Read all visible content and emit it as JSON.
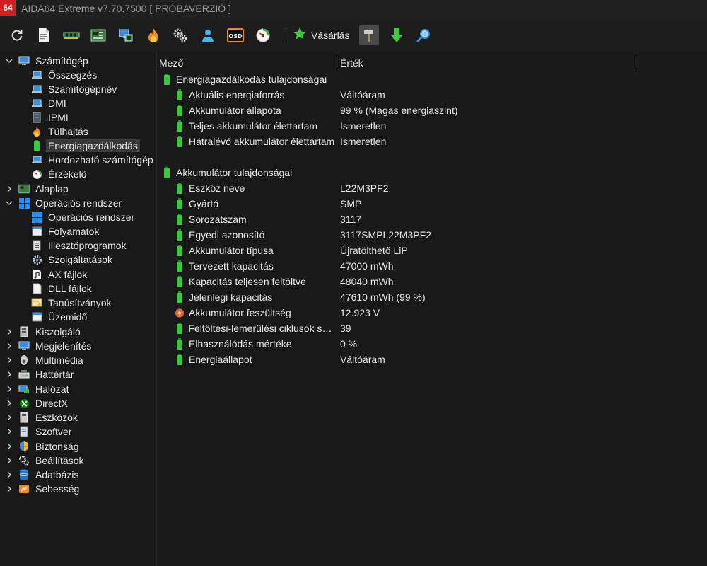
{
  "window": {
    "title": "AIDA64 Extreme v7.70.7500  [ PRÓBAVERZIÓ ]",
    "logo_text": "64"
  },
  "toolbar": {
    "buttons": [
      {
        "name": "refresh-icon"
      },
      {
        "name": "report-icon"
      },
      {
        "name": "memory-icon"
      },
      {
        "name": "motherboard-icon"
      },
      {
        "name": "network-icon"
      },
      {
        "name": "flame-icon"
      },
      {
        "name": "settings-gears-icon"
      },
      {
        "name": "user-icon"
      },
      {
        "name": "osd-icon"
      },
      {
        "name": "sensor-gauge-icon"
      }
    ],
    "buy_label": "Vásárlás",
    "osd_text": "OSD"
  },
  "tree": {
    "items": [
      {
        "label": "Számítógép"
      },
      {
        "label": "Összegzés"
      },
      {
        "label": "Számítógépnév"
      },
      {
        "label": "DMI"
      },
      {
        "label": "IPMI"
      },
      {
        "label": "Túlhajtás"
      },
      {
        "label": "Energiagazdálkodás"
      },
      {
        "label": "Hordozható számítógép"
      },
      {
        "label": "Érzékelő"
      },
      {
        "label": "Alaplap"
      },
      {
        "label": "Operációs rendszer"
      },
      {
        "label": "Operációs rendszer"
      },
      {
        "label": "Folyamatok"
      },
      {
        "label": "Illesztőprogramok"
      },
      {
        "label": "Szolgáltatások"
      },
      {
        "label": "AX fájlok"
      },
      {
        "label": "DLL fájlok"
      },
      {
        "label": "Tanúsítványok"
      },
      {
        "label": "Üzemidő"
      },
      {
        "label": "Kiszolgáló"
      },
      {
        "label": "Megjelenítés"
      },
      {
        "label": "Multimédia"
      },
      {
        "label": "Háttértár"
      },
      {
        "label": "Hálózat"
      },
      {
        "label": "DirectX"
      },
      {
        "label": "Eszközök"
      },
      {
        "label": "Szoftver"
      },
      {
        "label": "Biztonság"
      },
      {
        "label": "Beállítások"
      },
      {
        "label": "Adatbázis"
      },
      {
        "label": "Sebesség"
      }
    ]
  },
  "list": {
    "columns": {
      "field": "Mező",
      "value": "Érték"
    },
    "groups": [
      {
        "title": "Energiagazdálkodás tulajdonságai",
        "rows": [
          {
            "field": "Aktuális energiaforrás",
            "value": "Váltóáram"
          },
          {
            "field": "Akkumulátor állapota",
            "value": "99 % (Magas energiaszint)"
          },
          {
            "field": "Teljes akkumulátor élettartam",
            "value": "Ismeretlen"
          },
          {
            "field": "Hátralévő akkumulátor élettartam",
            "value": "Ismeretlen"
          }
        ]
      },
      {
        "title": "Akkumulátor tulajdonságai",
        "rows": [
          {
            "field": "Eszköz neve",
            "value": "L22M3PF2"
          },
          {
            "field": "Gyártó",
            "value": "SMP"
          },
          {
            "field": "Sorozatszám",
            "value": "3117"
          },
          {
            "field": "Egyedi azonosító",
            "value": "3117SMPL22M3PF2"
          },
          {
            "field": "Akkumulátor típusa",
            "value": "Újratölthető LiP"
          },
          {
            "field": "Tervezett kapacitás",
            "value": "47000 mWh"
          },
          {
            "field": "Kapacitás teljesen feltöltve",
            "value": "48040 mWh"
          },
          {
            "field": "Jelenlegi kapacitás",
            "value": "47610 mWh  (99 %)"
          },
          {
            "field": "Akkumulátor feszültség",
            "value": "12.923 V"
          },
          {
            "field": "Feltöltési-lemerülési ciklusok szá...",
            "value": "39"
          },
          {
            "field": "Elhasználódás mértéke",
            "value": "0 %"
          },
          {
            "field": "Energiaállapot",
            "value": "Váltóáram"
          }
        ]
      }
    ]
  },
  "colors": {
    "background": "#191919",
    "battery_green": "#3cc83c",
    "selection": "#3a3a3a",
    "logo_red": "#d21e1e"
  }
}
